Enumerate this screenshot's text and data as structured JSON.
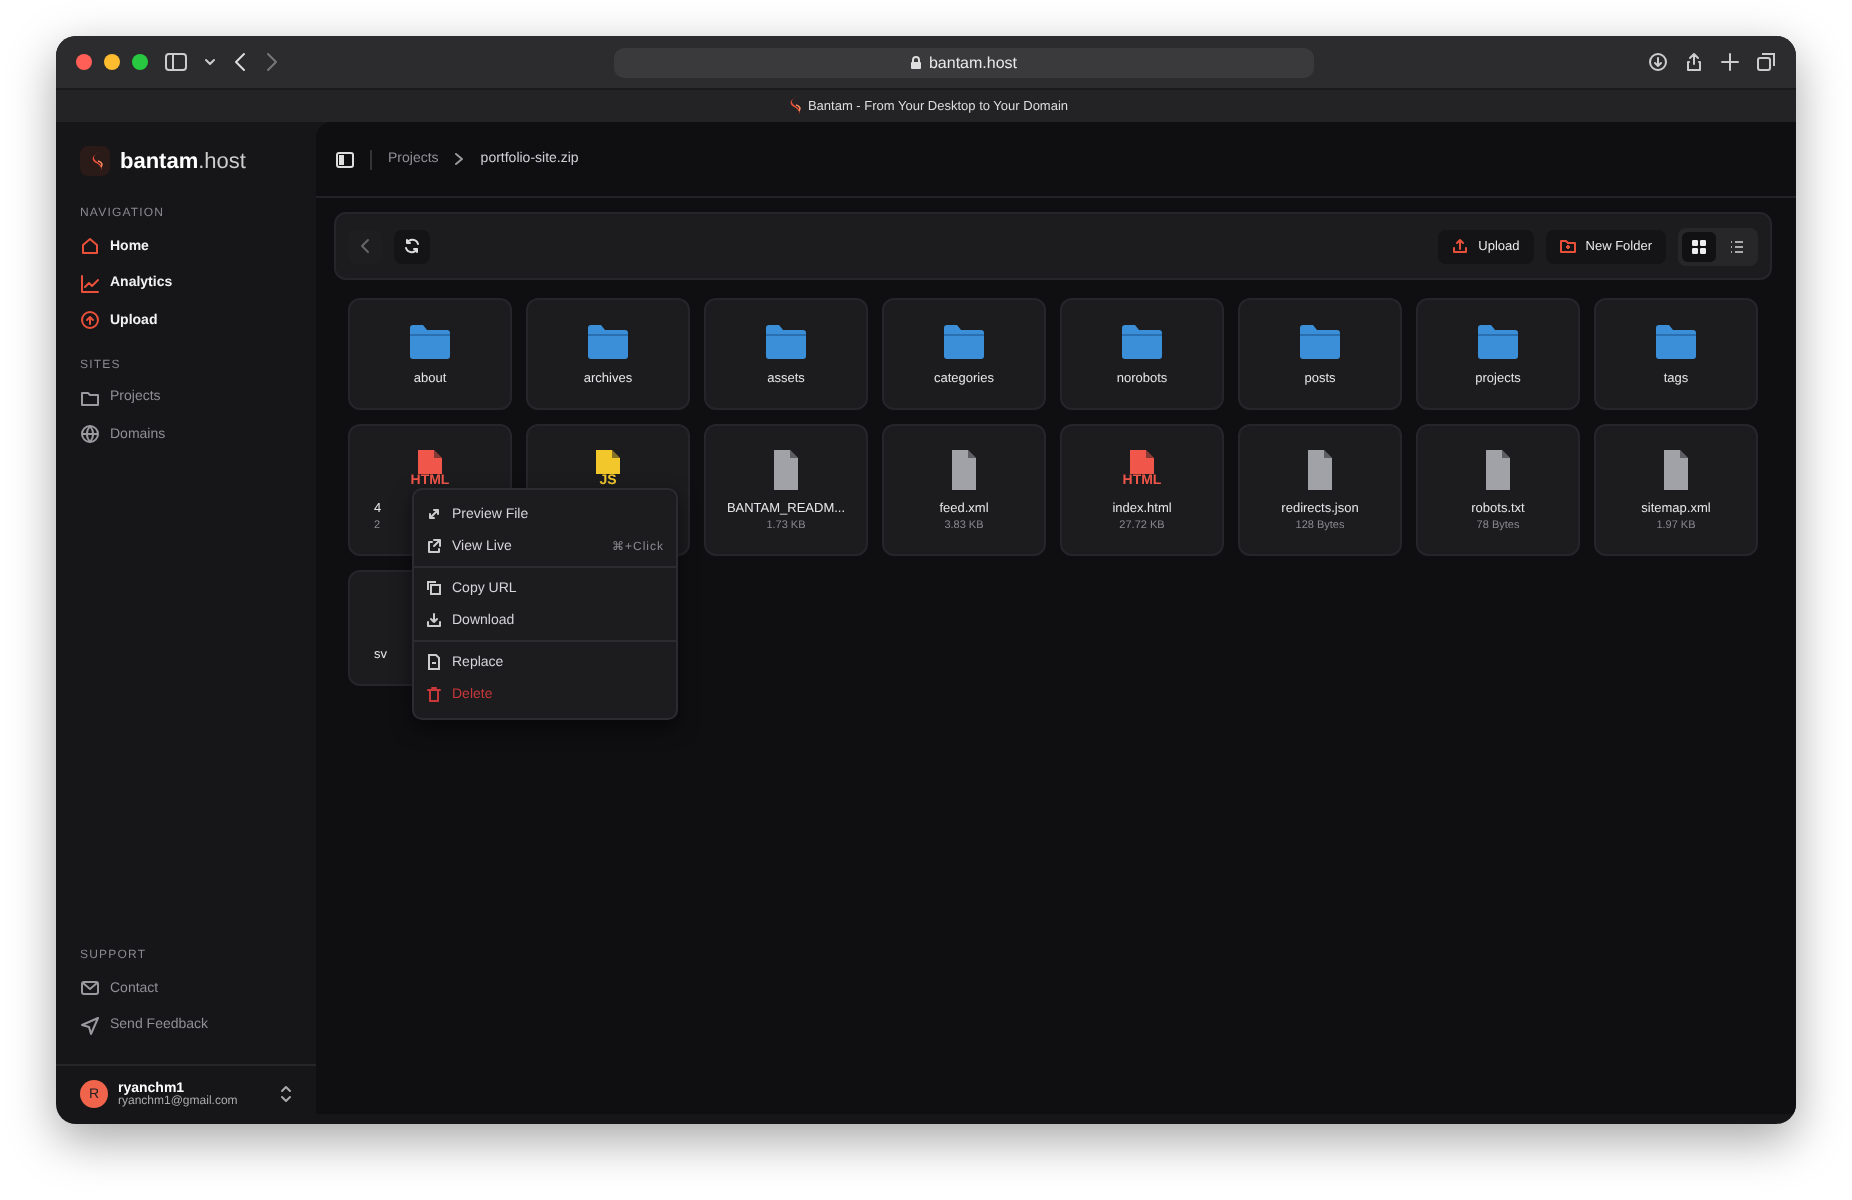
{
  "browser": {
    "url": "bantam.host",
    "tab_title": "Bantam - From Your Desktop to Your Domain"
  },
  "sidebar": {
    "brand": {
      "name": "bantam",
      "suffix": ".host"
    },
    "sections": [
      {
        "title": "NAVIGATION",
        "emphasis": true,
        "items": [
          {
            "label": "Home"
          },
          {
            "label": "Analytics"
          },
          {
            "label": "Upload"
          }
        ]
      },
      {
        "title": "SITES",
        "emphasis": false,
        "items": [
          {
            "label": "Projects"
          },
          {
            "label": "Domains"
          }
        ]
      }
    ],
    "support": {
      "title": "SUPPORT",
      "items": [
        {
          "label": "Contact"
        },
        {
          "label": "Send Feedback"
        }
      ]
    },
    "user": {
      "initial": "R",
      "name": "ryanchm1",
      "email": "ryanchm1@gmail.com"
    }
  },
  "breadcrumb": [
    "Projects",
    "portfolio-site.zip"
  ],
  "toolbar": {
    "buttons": [
      "Upload",
      "New Folder"
    ],
    "views": [
      {
        "kind": "grid",
        "selected": true
      },
      {
        "kind": "list",
        "selected": false
      }
    ]
  },
  "files": [
    {
      "kind": "folder",
      "name": "about"
    },
    {
      "kind": "folder",
      "name": "archives"
    },
    {
      "kind": "folder",
      "name": "assets"
    },
    {
      "kind": "folder",
      "name": "categories"
    },
    {
      "kind": "folder",
      "name": "norobots"
    },
    {
      "kind": "folder",
      "name": "posts"
    },
    {
      "kind": "folder",
      "name": "projects"
    },
    {
      "kind": "folder",
      "name": "tags"
    },
    {
      "kind": "html",
      "badge": "HTML",
      "name": "4",
      "size": "2",
      "partial": true,
      "context_menu": [
        [
          {
            "kind": "preview",
            "label": "Preview File"
          },
          {
            "kind": "external",
            "label": "View Live",
            "shortcut": "⌘+Click"
          }
        ],
        [
          {
            "kind": "copy",
            "label": "Copy URL"
          },
          {
            "kind": "download",
            "label": "Download"
          }
        ],
        [
          {
            "kind": "replace",
            "label": "Replace"
          },
          {
            "kind": "delete",
            "label": "Delete",
            "danger": true
          }
        ]
      ]
    },
    {
      "kind": "js",
      "badge": "JS",
      "partial": true
    },
    {
      "kind": "file",
      "name": "BANTAM_READM...",
      "size": "1.73 KB"
    },
    {
      "kind": "file",
      "name": "feed.xml",
      "size": "3.83 KB"
    },
    {
      "kind": "html",
      "badge": "HTML",
      "name": "index.html",
      "size": "27.72 KB"
    },
    {
      "kind": "file",
      "name": "redirects.json",
      "size": "128 Bytes"
    },
    {
      "kind": "file",
      "name": "robots.txt",
      "size": "78 Bytes"
    },
    {
      "kind": "file",
      "name": "sitemap.xml",
      "size": "1.97 KB"
    },
    {
      "kind": "blank",
      "name": "sv",
      "partial": true
    }
  ]
}
